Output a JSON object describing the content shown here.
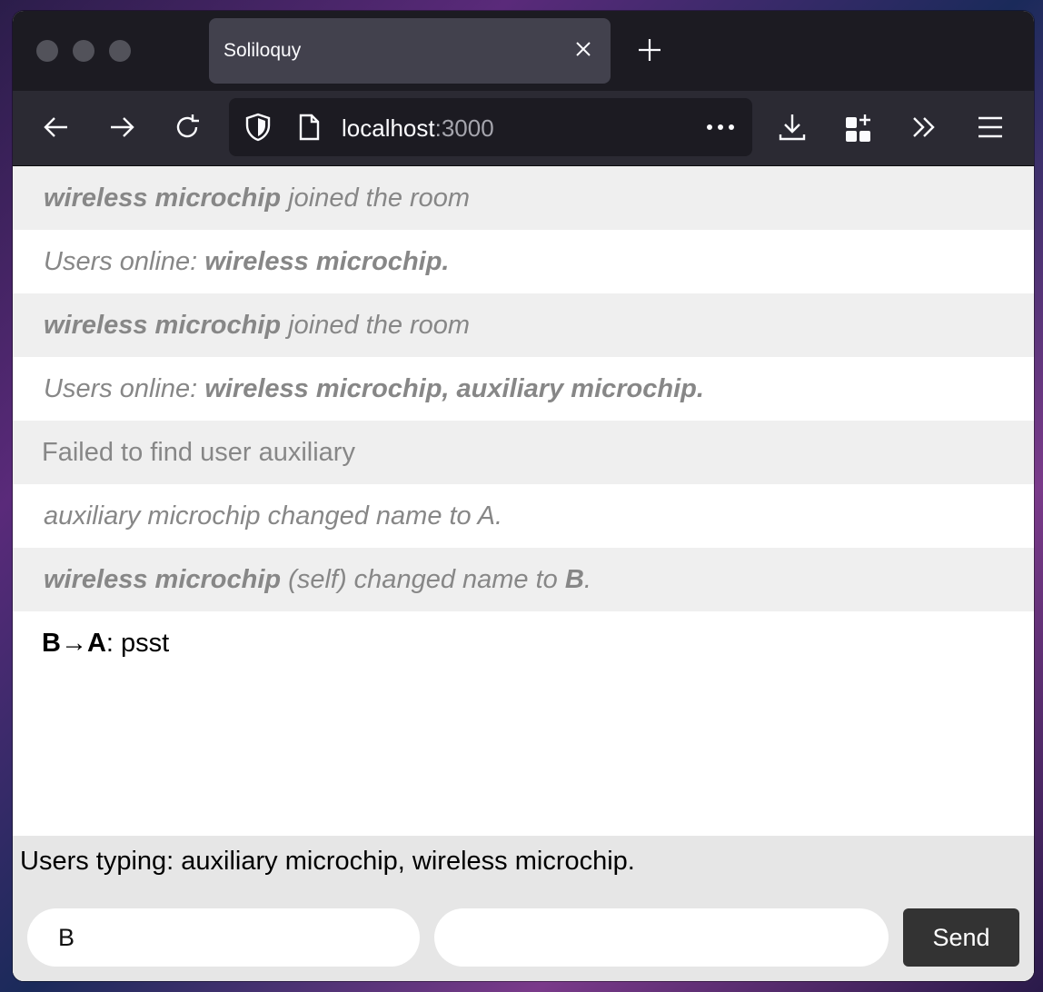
{
  "browser": {
    "tab_title": "Soliloquy",
    "url_host": "localhost",
    "url_port": ":3000"
  },
  "messages": [
    {
      "bold": "wireless microchip",
      "rest": " joined the room"
    },
    {
      "prefix": "Users online: ",
      "bold": "wireless microchip."
    },
    {
      "bold": "wireless microchip",
      "rest": " joined the room"
    },
    {
      "prefix": "Users online: ",
      "bold": "wireless microchip, auxiliary microchip."
    },
    {
      "text": "Failed to find user auxiliary"
    },
    {
      "text": "auxiliary microchip changed name to A."
    },
    {
      "bold": "wireless microchip",
      "rest": " (self) changed name to ",
      "bold2": "B",
      "end": "."
    },
    {
      "from_to": "B→A",
      "sep": ": ",
      "text": "psst"
    }
  ],
  "typing_status": "Users typing: auxiliary microchip, wireless microchip.",
  "form": {
    "name_value": "B",
    "message_value": "",
    "send_label": "Send"
  }
}
